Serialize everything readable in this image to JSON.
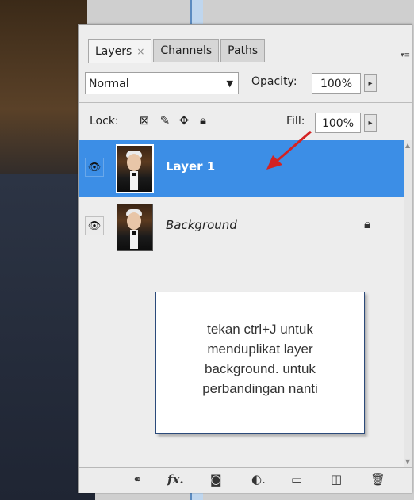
{
  "panel": {
    "tabs": [
      {
        "label": "Layers",
        "close": "×"
      },
      {
        "label": "Channels"
      },
      {
        "label": "Paths"
      }
    ],
    "blend_mode": "Normal",
    "opacity_label": "Opacity:",
    "opacity_value": "100%",
    "lock_label": "Lock:",
    "fill_label": "Fill:",
    "fill_value": "100%",
    "stepper_glyph": "▸",
    "layers": [
      {
        "name": "Layer 1",
        "selected": true,
        "visible": true
      },
      {
        "name": "Background",
        "selected": false,
        "visible": true,
        "locked": true
      }
    ]
  },
  "annotation": {
    "lines": [
      "tekan ctrl+J untuk",
      "menduplikat layer",
      "background. untuk",
      "perbandingan nanti"
    ]
  },
  "icons": [
    "eye-icon",
    "lock-transparency-icon",
    "brush-icon",
    "move-icon",
    "lock-all-icon",
    "link-icon",
    "fx-icon",
    "mask-icon",
    "adjustment-icon",
    "folder-icon",
    "new-layer-icon",
    "trash-icon"
  ],
  "colors": {
    "selection": "#3c8ee6",
    "annotation_arrow": "#d42222"
  }
}
